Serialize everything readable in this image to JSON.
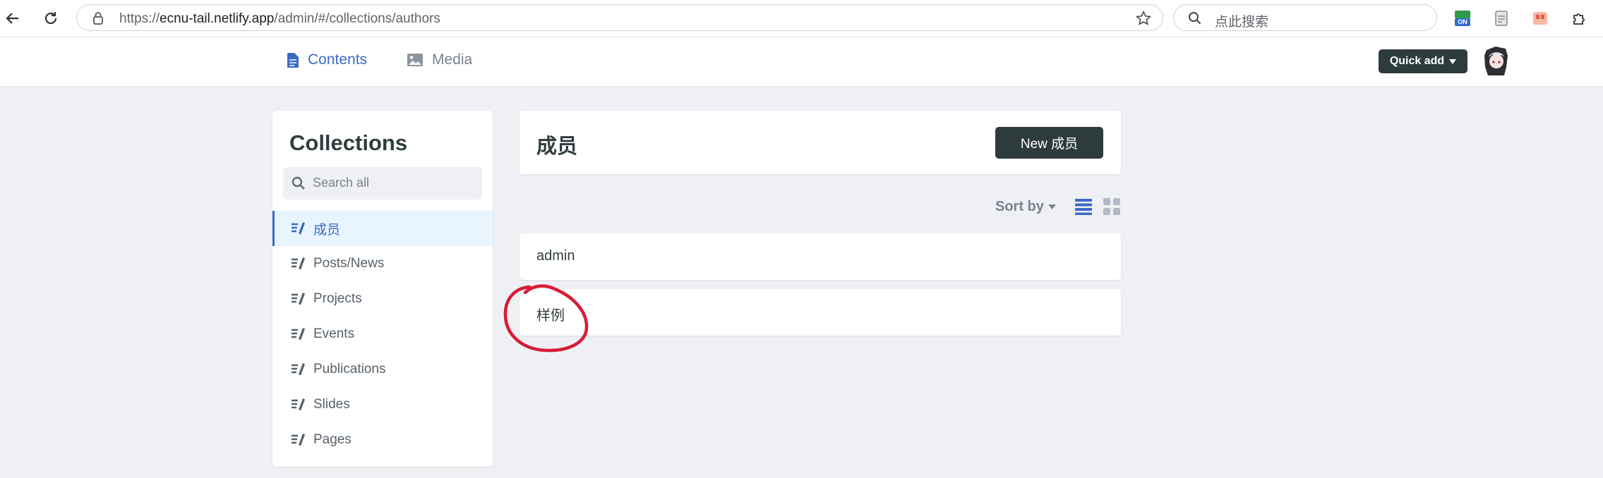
{
  "browser": {
    "url_prefix": "https://",
    "url_host": "ecnu-tail.netlify.app",
    "url_path": "/admin/#/collections/authors",
    "search_placeholder": "点此搜索",
    "ext_badge": "ON"
  },
  "header": {
    "nav": [
      {
        "label": "Contents",
        "icon": "document-icon",
        "active": true
      },
      {
        "label": "Media",
        "icon": "image-icon",
        "active": false
      }
    ],
    "quick_add_label": "Quick add"
  },
  "sidebar": {
    "title": "Collections",
    "search_placeholder": "Search all",
    "items": [
      {
        "label": "成员",
        "active": true
      },
      {
        "label": "Posts/News"
      },
      {
        "label": "Projects"
      },
      {
        "label": "Events"
      },
      {
        "label": "Publications"
      },
      {
        "label": "Slides"
      },
      {
        "label": "Pages"
      }
    ]
  },
  "collection": {
    "title": "成员",
    "new_button_label": "New 成员",
    "sort_label": "Sort by",
    "view_mode": "list",
    "entries": [
      "admin",
      "样例"
    ]
  },
  "colors": {
    "accent": "#3a69c7",
    "dark_button": "#2e3b3d",
    "background": "#eff0f4",
    "annotation": "#d81b35"
  }
}
